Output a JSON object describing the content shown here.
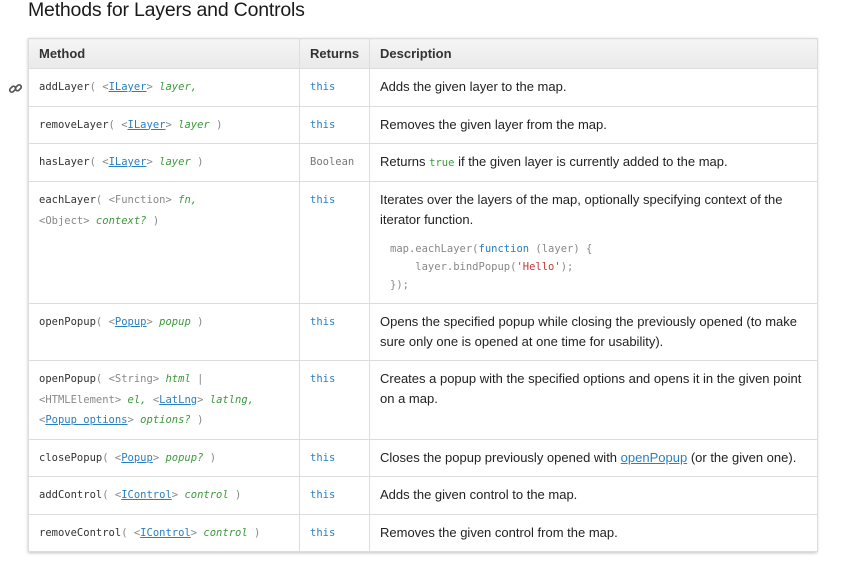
{
  "title": "Methods for Layers and Controls",
  "columns": {
    "method": "Method",
    "returns": "Returns",
    "description": "Description"
  },
  "rows": [
    {
      "name": "addLayer",
      "args": [
        {
          "type": "ILayer",
          "name": "layer,"
        }
      ],
      "returns": "this",
      "description": "Adds the given layer to the map."
    },
    {
      "name": "removeLayer",
      "args": [
        {
          "type": "ILayer",
          "name": "layer"
        }
      ],
      "returns": "this",
      "description": "Removes the given layer from the map."
    },
    {
      "name": "hasLayer",
      "args": [
        {
          "type": "ILayer",
          "name": "layer"
        }
      ],
      "returns": "Boolean",
      "description_pre": "Returns",
      "description_code": "true",
      "description_post": "if the given layer is currently added to the map."
    },
    {
      "name": "eachLayer",
      "args": [
        {
          "type": "Function",
          "name": "fn,"
        },
        {
          "type": "Object",
          "name": "context?"
        }
      ],
      "returns": "this",
      "description": "Iterates over the layers of the map, optionally specifying context of the iterator function.",
      "example": [
        "map.eachLayer(function (layer) {",
        "    layer.bindPopup('Hello');",
        "});"
      ]
    },
    {
      "name": "openPopup",
      "args": [
        {
          "type": "Popup",
          "name": "popup"
        }
      ],
      "returns": "this",
      "description": "Opens the specified popup while closing the previously opened (to make sure only one is opened at one time for usability)."
    },
    {
      "name": "openPopup",
      "args": [
        {
          "type": "String",
          "name": "html"
        },
        {
          "type": "HTMLElement",
          "name": "el,"
        },
        {
          "type": "LatLng",
          "name": "latlng,"
        },
        {
          "type": "Popup options",
          "name": "options?"
        }
      ],
      "returns": "this",
      "description": "Creates a popup with the specified options and opens it in the given point on a map."
    },
    {
      "name": "closePopup",
      "args": [
        {
          "type": "Popup",
          "name": "popup?"
        }
      ],
      "returns": "this",
      "description_pre": "Closes the popup previously opened with",
      "description_link": "openPopup",
      "description_post": "(or the given one)."
    },
    {
      "name": "addControl",
      "args": [
        {
          "type": "IControl",
          "name": "control"
        }
      ],
      "returns": "this",
      "description": "Adds the given control to the map."
    },
    {
      "name": "removeControl",
      "args": [
        {
          "type": "IControl",
          "name": "control"
        }
      ],
      "returns": "this",
      "description": "Removes the given control from the map."
    }
  ],
  "punct": {
    "open": "(",
    "close": ")",
    "pipe": "|",
    "lt": "<",
    "gt": ">"
  },
  "icons": {
    "anchor": "link-icon"
  }
}
